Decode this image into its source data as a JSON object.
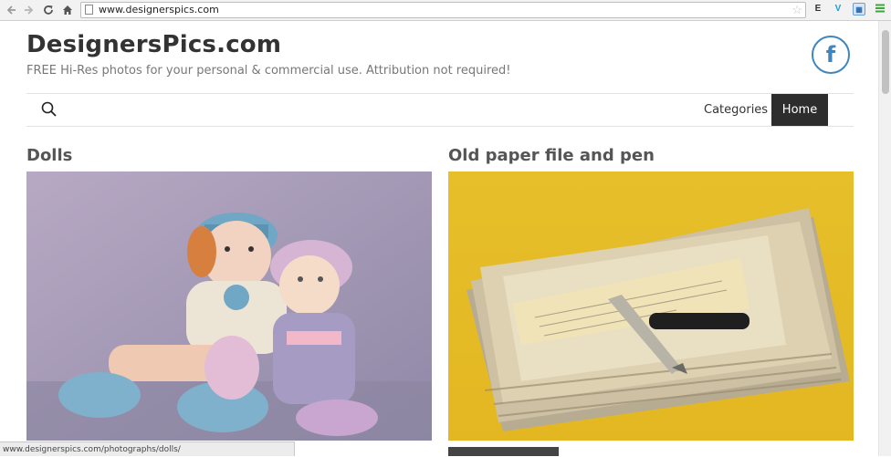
{
  "browser": {
    "url": "www.designerspics.com",
    "status_url": "www.designerspics.com/photographs/dolls/"
  },
  "site": {
    "title": "DesignersPics.com",
    "tagline": "FREE Hi-Res photos for your personal & commercial use. Attribution not required!",
    "facebook_icon_glyph": "f"
  },
  "nav": {
    "items": [
      {
        "label": "Categories"
      },
      {
        "label": "Home"
      }
    ]
  },
  "posts": [
    {
      "title": "Dolls"
    },
    {
      "title": "Old paper file and pen"
    }
  ],
  "icons": [
    "back-arrow-icon",
    "forward-arrow-icon",
    "reload-icon",
    "home-icon",
    "page-icon",
    "star-icon",
    "evernote-icon",
    "vimeo-icon",
    "calendar-icon",
    "menu-icon",
    "search-icon",
    "facebook-icon"
  ],
  "colors": {
    "accent": "#3f86bf",
    "nav_active_bg": "#2d2d2d",
    "title_text": "#333333"
  }
}
